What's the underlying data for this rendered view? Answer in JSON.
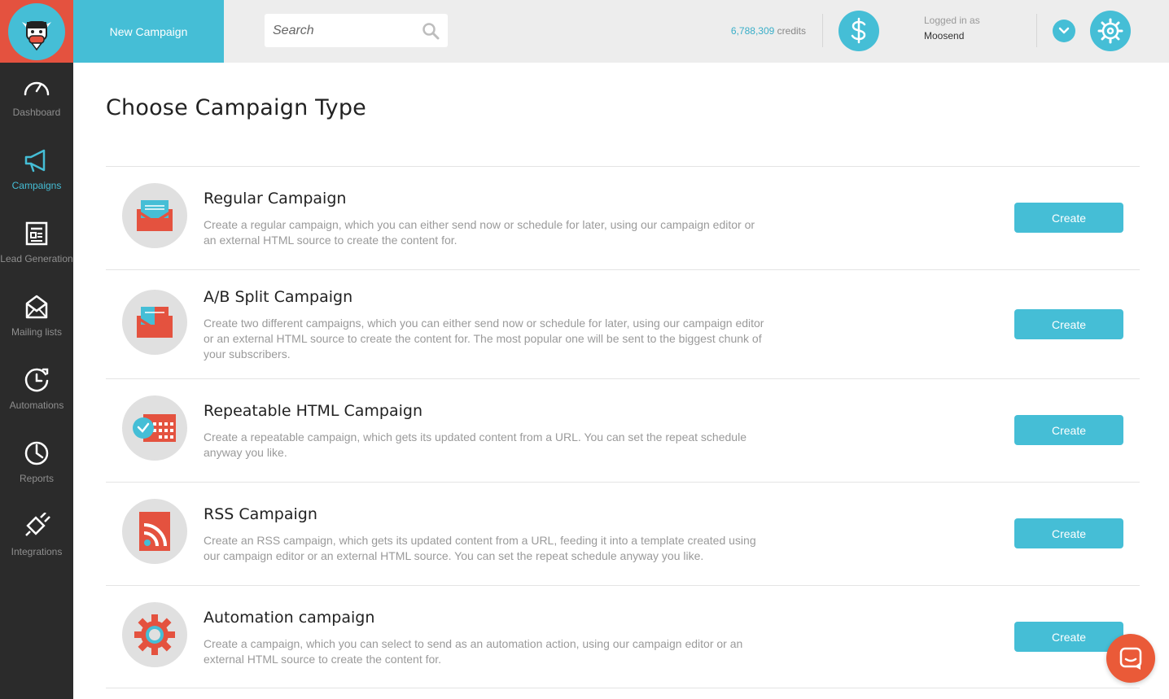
{
  "header": {
    "new_campaign_label": "New Campaign",
    "search_placeholder": "Search",
    "credits_number": "6,788,309",
    "credits_label": "credits",
    "logged_in_label": "Logged in as",
    "username": "Moosend"
  },
  "sidebar": {
    "items": [
      {
        "label": "Dashboard",
        "icon": "speedometer-icon",
        "active": false
      },
      {
        "label": "Campaigns",
        "icon": "megaphone-icon",
        "active": true
      },
      {
        "label": "Lead Generation",
        "icon": "form-icon",
        "active": false
      },
      {
        "label": "Mailing lists",
        "icon": "envelope-icon",
        "active": false
      },
      {
        "label": "Automations",
        "icon": "clock-arrow-icon",
        "active": false
      },
      {
        "label": "Reports",
        "icon": "pie-chart-icon",
        "active": false
      },
      {
        "label": "Integrations",
        "icon": "plug-icon",
        "active": false
      }
    ]
  },
  "main": {
    "title": "Choose Campaign Type",
    "campaigns": [
      {
        "title": "Regular Campaign",
        "description": "Create a regular campaign, which you can either send now or schedule for later, using our campaign editor or an external HTML source to create the content for.",
        "button": "Create",
        "icon": "envelope-icon"
      },
      {
        "title": "A/B Split Campaign",
        "description": "Create two different campaigns, which you can either send now or schedule for later, using our campaign editor or an external HTML source to create the content for. The most popular one will be sent to the biggest chunk of your subscribers.",
        "button": "Create",
        "icon": "split-envelope-icon"
      },
      {
        "title": "Repeatable HTML Campaign",
        "description": "Create a repeatable campaign, which gets its updated content from a URL. You can set the repeat schedule anyway you like.",
        "button": "Create",
        "icon": "calendar-clock-icon"
      },
      {
        "title": "RSS Campaign",
        "description": "Create an RSS campaign, which gets its updated content from a URL, feeding it into a template created using our campaign editor or an external HTML source. You can set the repeat schedule anyway you like.",
        "button": "Create",
        "icon": "rss-icon"
      },
      {
        "title": "Automation campaign",
        "description": "Create a campaign, which you can select to send as an automation action, using our campaign editor or an external HTML source to create the content for.",
        "button": "Create",
        "icon": "gear-icon"
      }
    ]
  },
  "colors": {
    "accent": "#45bed6",
    "brand_red": "#e4523f",
    "sidebar_bg": "#2b2b2b",
    "chat": "#ea5a38"
  }
}
